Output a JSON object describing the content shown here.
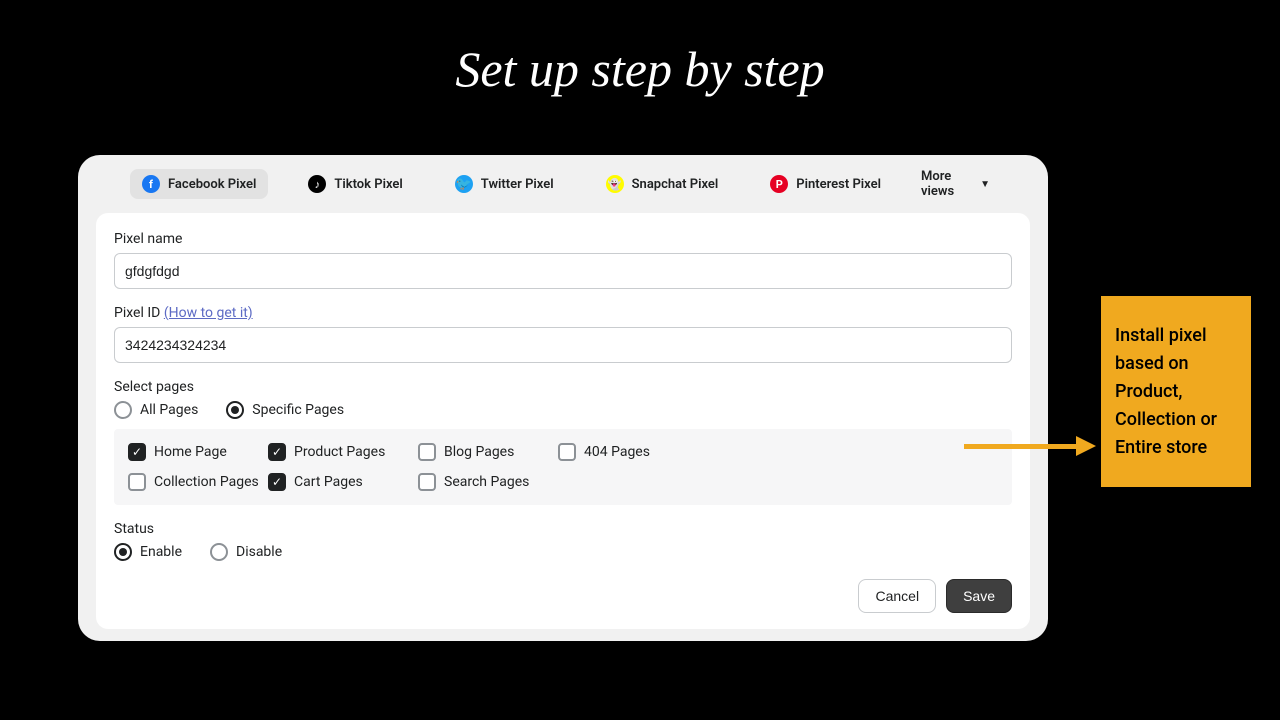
{
  "heading": "Set up step by step",
  "tabs": {
    "facebook": "Facebook Pixel",
    "tiktok": "Tiktok Pixel",
    "twitter": "Twitter Pixel",
    "snapchat": "Snapchat Pixel",
    "pinterest": "Pinterest Pixel",
    "more": "More views"
  },
  "form": {
    "pixelName": {
      "label": "Pixel name",
      "value": "gfdgfdgd"
    },
    "pixelId": {
      "label": "Pixel ID",
      "link": "(How to get it)",
      "value": "3424234324234"
    },
    "selectPages": {
      "label": "Select pages",
      "all": "All Pages",
      "specific": "Specific Pages"
    },
    "pages": {
      "home": "Home Page",
      "product": "Product Pages",
      "blog": "Blog Pages",
      "notfound": "404 Pages",
      "collection": "Collection Pages",
      "cart": "Cart Pages",
      "search": "Search Pages"
    },
    "status": {
      "label": "Status",
      "enable": "Enable",
      "disable": "Disable"
    },
    "actions": {
      "cancel": "Cancel",
      "save": "Save"
    }
  },
  "callout": "Install pixel based on Product, Collection or Entire store",
  "icons": {
    "facebook_bg": "#1877f2",
    "tiktok_bg": "#000000",
    "twitter_bg": "#1da1f2",
    "snapchat_bg": "#fffc00",
    "pinterest_bg": "#e60023"
  }
}
